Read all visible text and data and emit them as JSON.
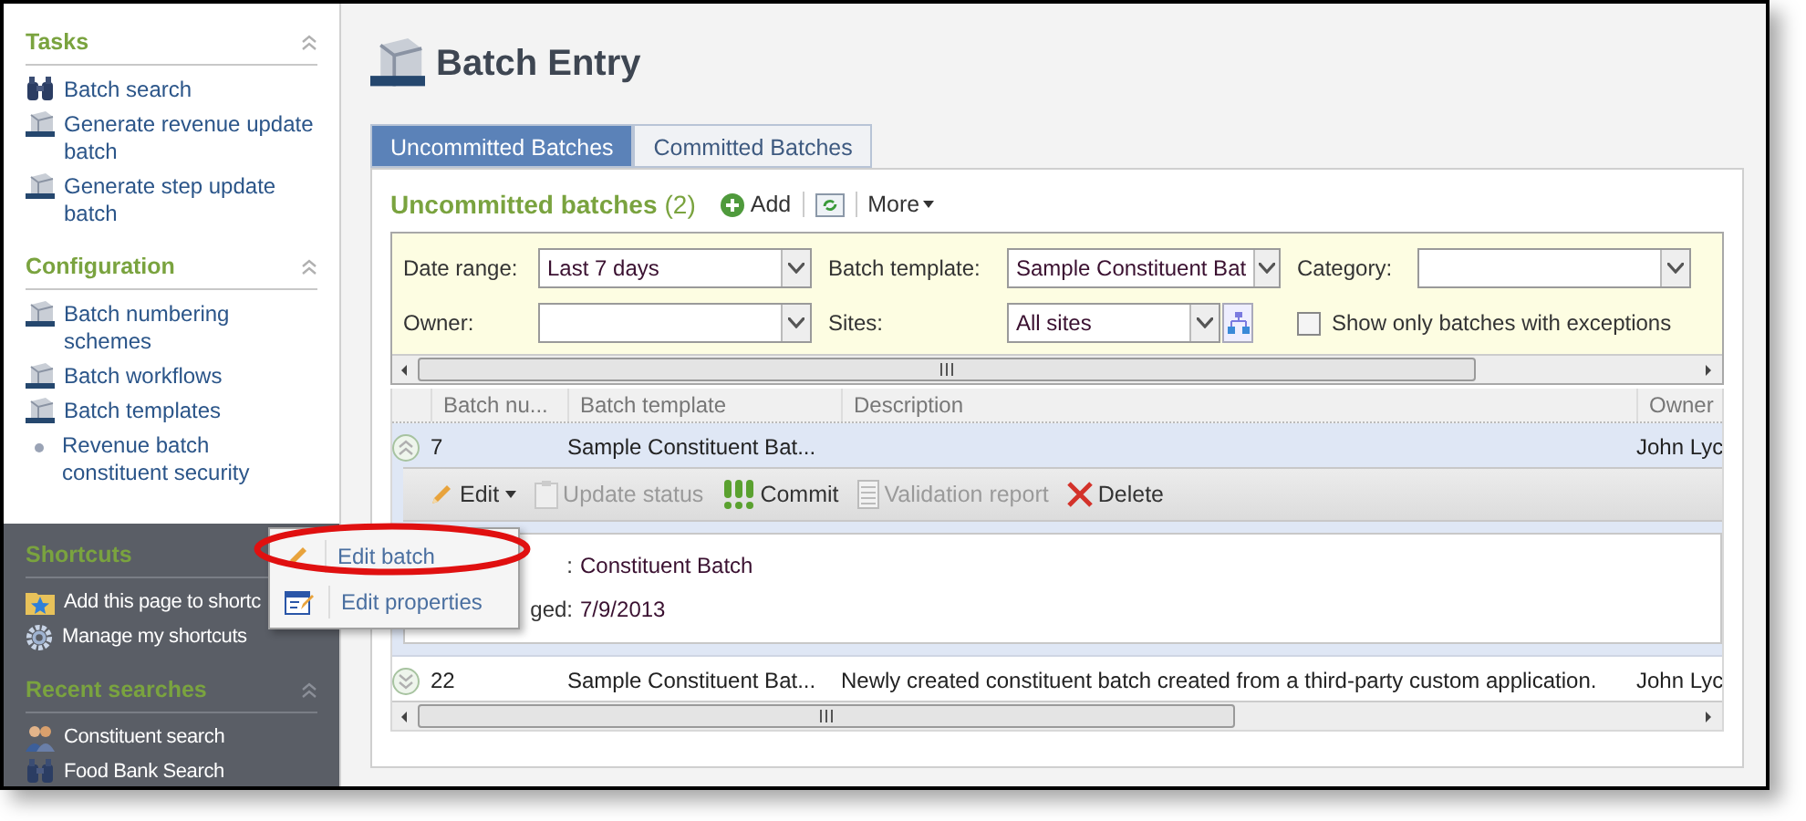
{
  "sidebar": {
    "top_sections": [
      {
        "title": "Tasks",
        "collapsible": true,
        "items": [
          {
            "label": "Batch search",
            "kind": "binoculars"
          },
          {
            "label": "Generate revenue update batch",
            "kind": "batch"
          },
          {
            "label": "Generate step update batch",
            "kind": "batch"
          }
        ]
      },
      {
        "title": "Configuration",
        "collapsible": true,
        "items": [
          {
            "label": "Batch numbering schemes",
            "kind": "batch"
          },
          {
            "label": "Batch workflows",
            "kind": "batch"
          },
          {
            "label": "Batch templates",
            "kind": "batch"
          },
          {
            "label": "Revenue batch constituent security",
            "kind": "bullet"
          }
        ]
      }
    ],
    "bottom_sections": [
      {
        "title": "Shortcuts",
        "collapsible": false,
        "items": [
          {
            "label": "Add this page to shortc",
            "kind": "star-folder"
          },
          {
            "label": "Manage my shortcuts",
            "kind": "gear"
          }
        ]
      },
      {
        "title": "Recent searches",
        "collapsible": true,
        "items": [
          {
            "label": "Constituent search",
            "kind": "people"
          },
          {
            "label": "Food Bank Search",
            "kind": "binoculars"
          }
        ]
      }
    ]
  },
  "page": {
    "title": "Batch Entry"
  },
  "tabs": [
    {
      "label": "Uncommitted Batches",
      "selected": true
    },
    {
      "label": "Committed Batches",
      "selected": false
    }
  ],
  "list": {
    "title": "Uncommitted batches",
    "count": "(2)",
    "add": "Add",
    "more": "More"
  },
  "filters": {
    "date_range": {
      "label": "Date range:",
      "value": "Last 7 days"
    },
    "batch_template": {
      "label": "Batch template:",
      "value": "Sample Constituent Bat"
    },
    "category": {
      "label": "Category:"
    },
    "owner": {
      "label": "Owner:"
    },
    "sites": {
      "label": "Sites:",
      "value": "All sites"
    },
    "exceptions": {
      "label": "Show only batches with exceptions",
      "checked": false
    }
  },
  "table": {
    "columns": [
      "Batch nu...",
      "Batch template",
      "Description",
      "Owner"
    ],
    "rows": [
      {
        "cells": [
          "7",
          "Sample Constituent Bat...",
          "",
          "John Lyc"
        ],
        "expanded": true,
        "selected": true
      },
      {
        "cells": [
          "22",
          "Sample Constituent Bat...",
          "Newly created constituent batch created from a third-party custom application.",
          "John Lyc"
        ],
        "expanded": false,
        "selected": false
      }
    ]
  },
  "row_actions": [
    {
      "label": "Edit",
      "kind": "edit",
      "disabled": false
    },
    {
      "label": "Update status",
      "kind": "status",
      "disabled": true
    },
    {
      "label": "Commit",
      "kind": "commit",
      "disabled": false
    },
    {
      "label": "Validation report",
      "kind": "report",
      "disabled": true
    },
    {
      "label": "Delete",
      "kind": "delete",
      "disabled": false
    }
  ],
  "details": [
    {
      "label": ":",
      "value": "Constituent Batch"
    },
    {
      "label": "ged:",
      "value": "7/9/2013"
    }
  ],
  "edit_menu": [
    {
      "label": "Edit batch",
      "kind": "pencil",
      "circled": true
    },
    {
      "label": "Edit properties",
      "kind": "properties",
      "circled": false
    }
  ]
}
